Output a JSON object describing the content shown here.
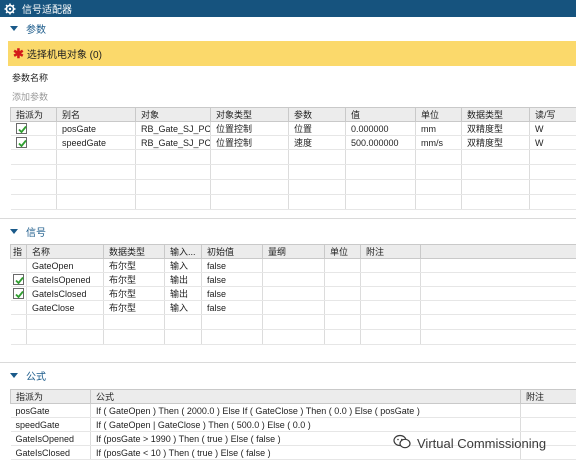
{
  "window": {
    "title": "信号适配器"
  },
  "params": {
    "section_title": "参数",
    "banner_text": "选择机电对象 (0)",
    "param_name_label": "参数名称",
    "add_param_placeholder": "添加参数",
    "columns": [
      "指派为",
      "别名",
      "对象",
      "对象类型",
      "参数",
      "值",
      "单位",
      "数据类型",
      "读/写"
    ],
    "rows": [
      {
        "assigned": true,
        "alias": "posGate",
        "object": "RB_Gate_SJ_PC",
        "object_type": "位置控制",
        "param": "位置",
        "value": "0.000000",
        "unit": "mm",
        "data_type": "双精度型",
        "rw": "W"
      },
      {
        "assigned": true,
        "alias": "speedGate",
        "object": "RB_Gate_SJ_PC",
        "object_type": "位置控制",
        "param": "速度",
        "value": "500.000000",
        "unit": "mm/s",
        "data_type": "双精度型",
        "rw": "W"
      }
    ]
  },
  "signals": {
    "section_title": "信号",
    "columns": [
      "指",
      "名称",
      "数据类型",
      "输入...",
      "初始值",
      "量纲",
      "单位",
      "附注"
    ],
    "rows": [
      {
        "assigned": false,
        "name": "GateOpen",
        "data_type": "布尔型",
        "io": "输入",
        "initial": "false"
      },
      {
        "assigned": true,
        "name": "GateIsOpened",
        "data_type": "布尔型",
        "io": "输出",
        "initial": "false"
      },
      {
        "assigned": true,
        "name": "GateIsClosed",
        "data_type": "布尔型",
        "io": "输出",
        "initial": "false"
      },
      {
        "assigned": false,
        "name": "GateClose",
        "data_type": "布尔型",
        "io": "输入",
        "initial": "false"
      }
    ]
  },
  "formulas": {
    "section_title": "公式",
    "columns": [
      "指派为",
      "公式",
      "附注"
    ],
    "rows": [
      {
        "assigned_to": "posGate",
        "formula": "If ( GateOpen ) Then ( 2000.0 ) Else If ( GateClose ) Then ( 0.0 ) Else ( posGate )"
      },
      {
        "assigned_to": "speedGate",
        "formula": "If ( GateOpen | GateClose ) Then ( 500.0 )  Else ( 0.0 )"
      },
      {
        "assigned_to": "GateIsOpened",
        "formula": "If (posGate > 1990 ) Then ( true ) Else ( false )"
      },
      {
        "assigned_to": "GateIsClosed",
        "formula": "If (posGate < 10 ) Then ( true ) Else ( false )"
      }
    ]
  },
  "watermark": {
    "text": "Virtual Commissioning"
  },
  "colors": {
    "titlebar": "#16537e",
    "banner": "#fbd96b",
    "section_text": "#1a5a8a",
    "required_star": "#d31a1a",
    "check": "#2f9e2f"
  }
}
